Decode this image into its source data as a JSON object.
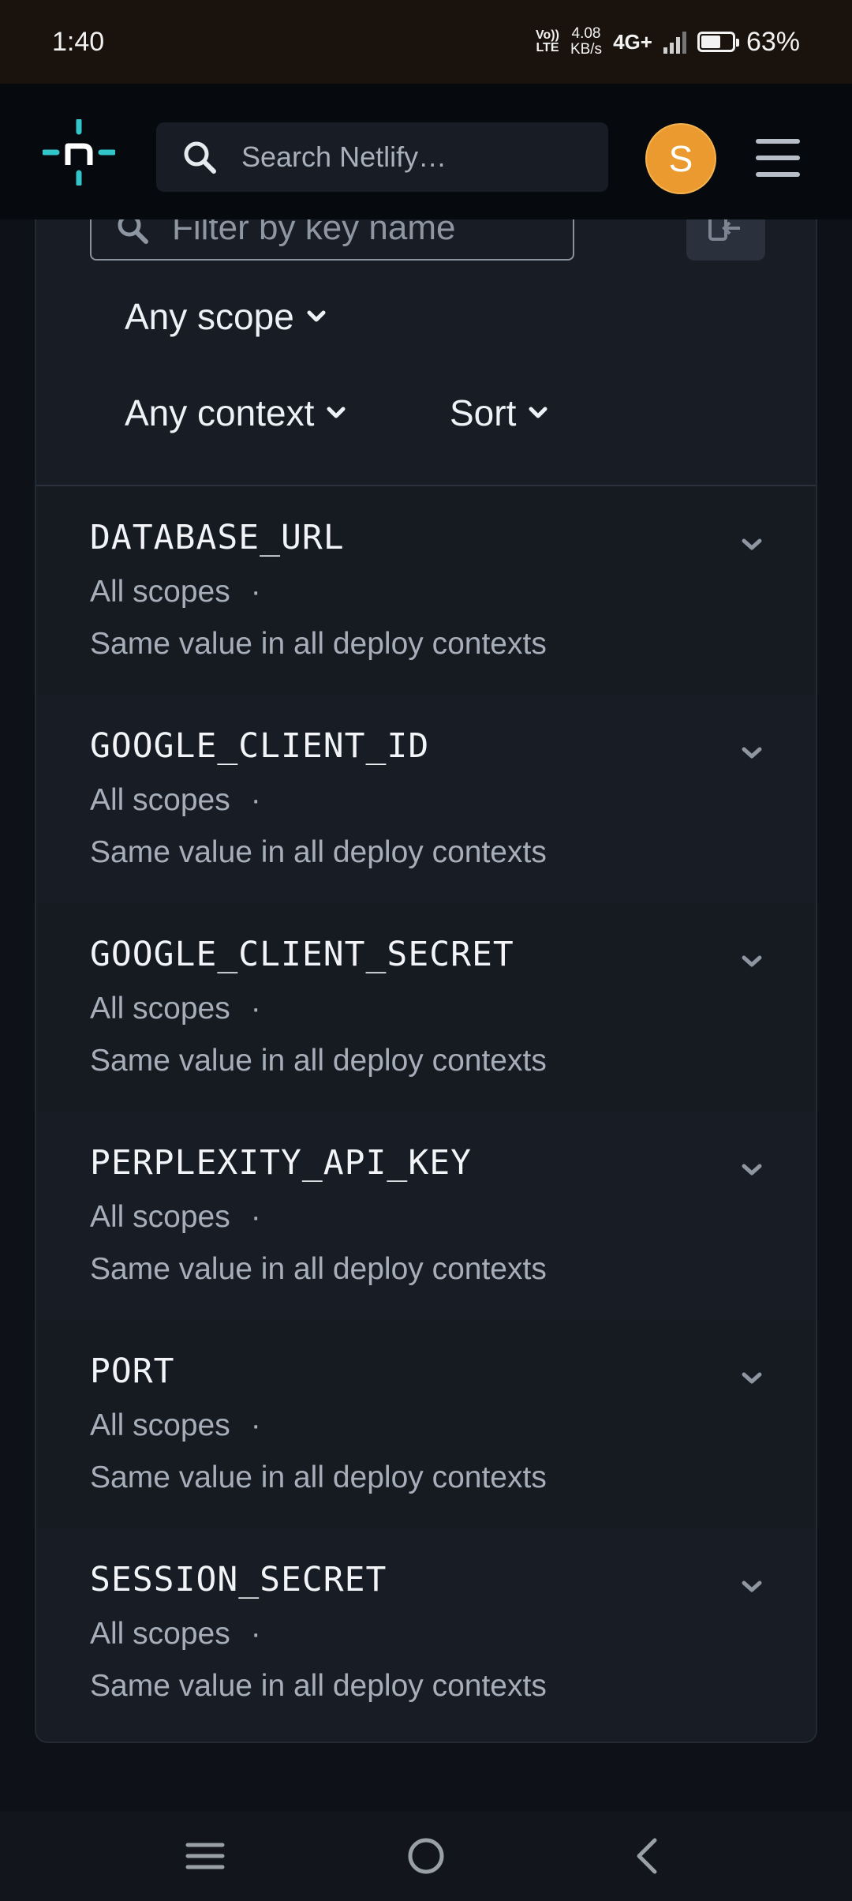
{
  "status_bar": {
    "time": "1:40",
    "volte_label": "Vo)) LTE",
    "net_speed": "4.08 KB/s",
    "net_type": "4G+",
    "battery": "63%"
  },
  "header": {
    "logo_icon": "netlify-logo",
    "search_placeholder": "Search Netlify…",
    "avatar_letter": "S",
    "menu_icon": "hamburger-icon",
    "colors": {
      "avatar": "#ea9a2e",
      "logo": "#32c5c9"
    }
  },
  "filters": {
    "filter_placeholder": "Filter by key name",
    "scope_label": "Any scope",
    "context_label": "Any context",
    "sort_label": "Sort"
  },
  "variables": [
    {
      "name": "DATABASE_URL",
      "scopes": "All scopes",
      "separator": "·",
      "contexts": "Same value in all deploy contexts"
    },
    {
      "name": "GOOGLE_CLIENT_ID",
      "scopes": "All scopes",
      "separator": "·",
      "contexts": "Same value in all deploy contexts"
    },
    {
      "name": "GOOGLE_CLIENT_SECRET",
      "scopes": "All scopes",
      "separator": "·",
      "contexts": "Same value in all deploy contexts"
    },
    {
      "name": "PERPLEXITY_API_KEY",
      "scopes": "All scopes",
      "separator": "·",
      "contexts": "Same value in all deploy contexts"
    },
    {
      "name": "PORT",
      "scopes": "All scopes",
      "separator": "·",
      "contexts": "Same value in all deploy contexts"
    },
    {
      "name": "SESSION_SECRET",
      "scopes": "All scopes",
      "separator": "·",
      "contexts": "Same value in all deploy contexts"
    }
  ],
  "nav": {
    "recents_icon": "menu-lines-icon",
    "home_icon": "home-circle-icon",
    "back_icon": "back-chevron-icon"
  }
}
